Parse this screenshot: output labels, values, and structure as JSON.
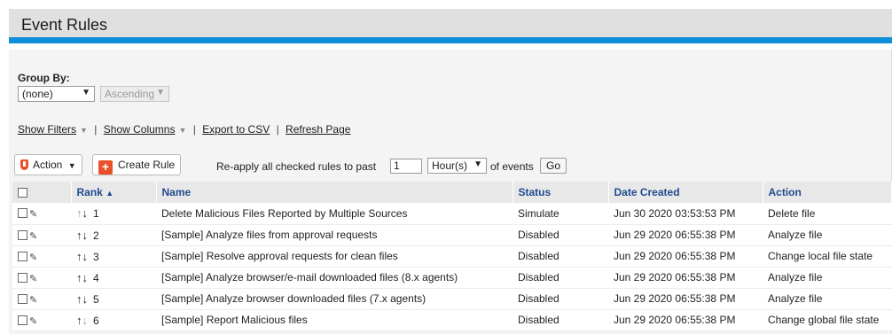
{
  "header": {
    "title": "Event Rules"
  },
  "group_by": {
    "label": "Group By:",
    "field_value": "(none)",
    "order_value": "Ascending"
  },
  "links": {
    "show_filters": "Show Filters",
    "show_columns": "Show Columns",
    "export_csv": "Export to CSV",
    "refresh": "Refresh Page"
  },
  "toolbar": {
    "action_label": "Action",
    "create_rule_label": "Create Rule",
    "reapply_prefix": "Re-apply all checked rules to past",
    "reapply_value": "1",
    "reapply_unit": "Hour(s)",
    "reapply_suffix": "of events",
    "go_label": "Go"
  },
  "table": {
    "columns": [
      "Rank",
      "Name",
      "Status",
      "Date Created",
      "Action"
    ],
    "sort_indicator": "▲",
    "rows": [
      {
        "rank": "1",
        "name": "Delete Malicious Files Reported by Multiple Sources",
        "status": "Simulate",
        "date": "Jun 30 2020 03:53:53 PM",
        "action": "Delete file",
        "up_disabled": true,
        "down_disabled": false
      },
      {
        "rank": "2",
        "name": "[Sample] Analyze files from approval requests",
        "status": "Disabled",
        "date": "Jun 29 2020 06:55:38 PM",
        "action": "Analyze file",
        "up_disabled": false,
        "down_disabled": false
      },
      {
        "rank": "3",
        "name": "[Sample] Resolve approval requests for clean files",
        "status": "Disabled",
        "date": "Jun 29 2020 06:55:38 PM",
        "action": "Change local file state",
        "up_disabled": false,
        "down_disabled": false
      },
      {
        "rank": "4",
        "name": "[Sample] Analyze browser/e-mail downloaded files (8.x agents)",
        "status": "Disabled",
        "date": "Jun 29 2020 06:55:38 PM",
        "action": "Analyze file",
        "up_disabled": false,
        "down_disabled": false
      },
      {
        "rank": "5",
        "name": "[Sample] Analyze browser downloaded files (7.x agents)",
        "status": "Disabled",
        "date": "Jun 29 2020 06:55:38 PM",
        "action": "Analyze file",
        "up_disabled": false,
        "down_disabled": false
      },
      {
        "rank": "6",
        "name": "[Sample] Report Malicious files",
        "status": "Disabled",
        "date": "Jun 29 2020 06:55:38 PM",
        "action": "Change global file state",
        "up_disabled": false,
        "down_disabled": true
      }
    ]
  },
  "colors": {
    "accent_bar": "#0e8fd8",
    "icon_orange": "#e8512b",
    "header_link": "#1f4b8f"
  }
}
